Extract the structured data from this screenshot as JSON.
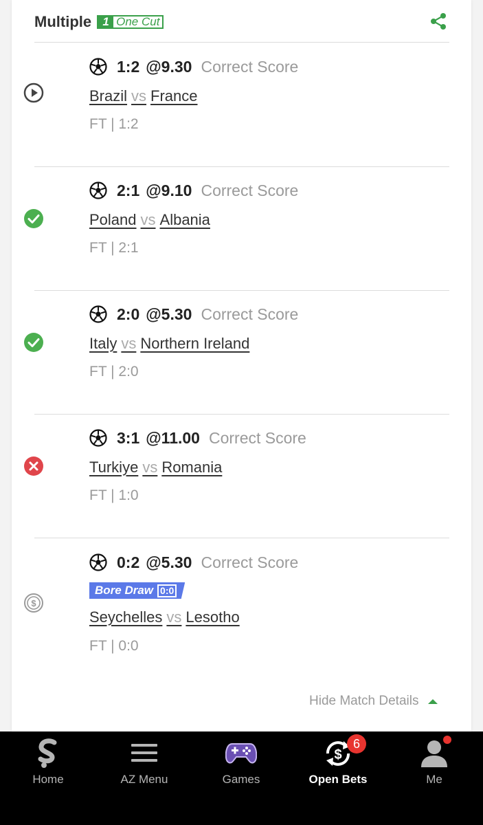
{
  "header": {
    "title": "Multiple",
    "one_cut_mark": "1",
    "one_cut_label": "One Cut"
  },
  "legs": [
    {
      "status": "play",
      "pick": "1:2",
      "odds": "@9.30",
      "market": "Correct Score",
      "home": "Brazil",
      "vs": "vs",
      "away": "France",
      "result": "FT | 1:2"
    },
    {
      "status": "won",
      "pick": "2:1",
      "odds": "@9.10",
      "market": "Correct Score",
      "home": "Poland",
      "vs": "vs",
      "away": "Albania",
      "result": "FT | 2:1"
    },
    {
      "status": "won",
      "pick": "2:0",
      "odds": "@5.30",
      "market": "Correct Score",
      "home": "Italy",
      "vs": "vs",
      "away": "Northern Ireland",
      "result": "FT | 2:0"
    },
    {
      "status": "lost",
      "pick": "3:1",
      "odds": "@11.00",
      "market": "Correct Score",
      "home": "Turkiye",
      "vs": "vs",
      "away": "Romania",
      "result": "FT | 1:0"
    },
    {
      "status": "refund",
      "pick": "0:2",
      "odds": "@5.30",
      "market": "Correct Score",
      "badge": "Bore Draw",
      "badge_score": "0:0",
      "home": "Seychelles",
      "vs": "vs",
      "away": "Lesotho",
      "result": "FT | 0:0"
    }
  ],
  "footer": {
    "hide_details": "Hide Match Details"
  },
  "nav": [
    {
      "label": "Home",
      "icon": "sporty-logo-icon"
    },
    {
      "label": "AZ Menu",
      "icon": "hamburger-menu-icon"
    },
    {
      "label": "Games",
      "icon": "gamepad-icon"
    },
    {
      "label": "Open Bets",
      "icon": "open-bets-icon",
      "badge": "6"
    },
    {
      "label": "Me",
      "icon": "user-icon"
    }
  ],
  "colors": {
    "accent_green": "#3aa04a",
    "won": "#4caf50",
    "lost": "#e0454b",
    "badge_blue": "#5b79e8",
    "notification_red": "#e8342f"
  }
}
